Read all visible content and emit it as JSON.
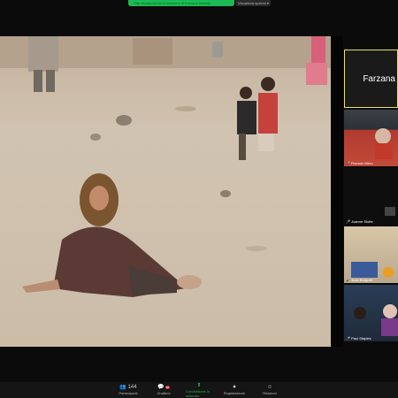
{
  "banner": {
    "text": "Stai visualizzando lo schermo di Farzana Wahidy",
    "options": "Visualizza opzioni"
  },
  "gallery": {
    "speaker": "Farzana",
    "tiles": [
      {
        "name": "Romain Niero"
      },
      {
        "name": "Joanne Stolte"
      },
      {
        "name": "Juan Burguet"
      },
      {
        "name": "Paul Staples"
      }
    ]
  },
  "toolbar": {
    "participants": "Partecipanti",
    "participants_count": "144",
    "chat": "Chatbox",
    "chat_badge": "32",
    "share": "Condivisione lo schermo",
    "record": "Registrazione",
    "reactions": "Reazioni"
  },
  "colors": {
    "speaker_border": "#e8e34a",
    "accent": "#1db954"
  }
}
